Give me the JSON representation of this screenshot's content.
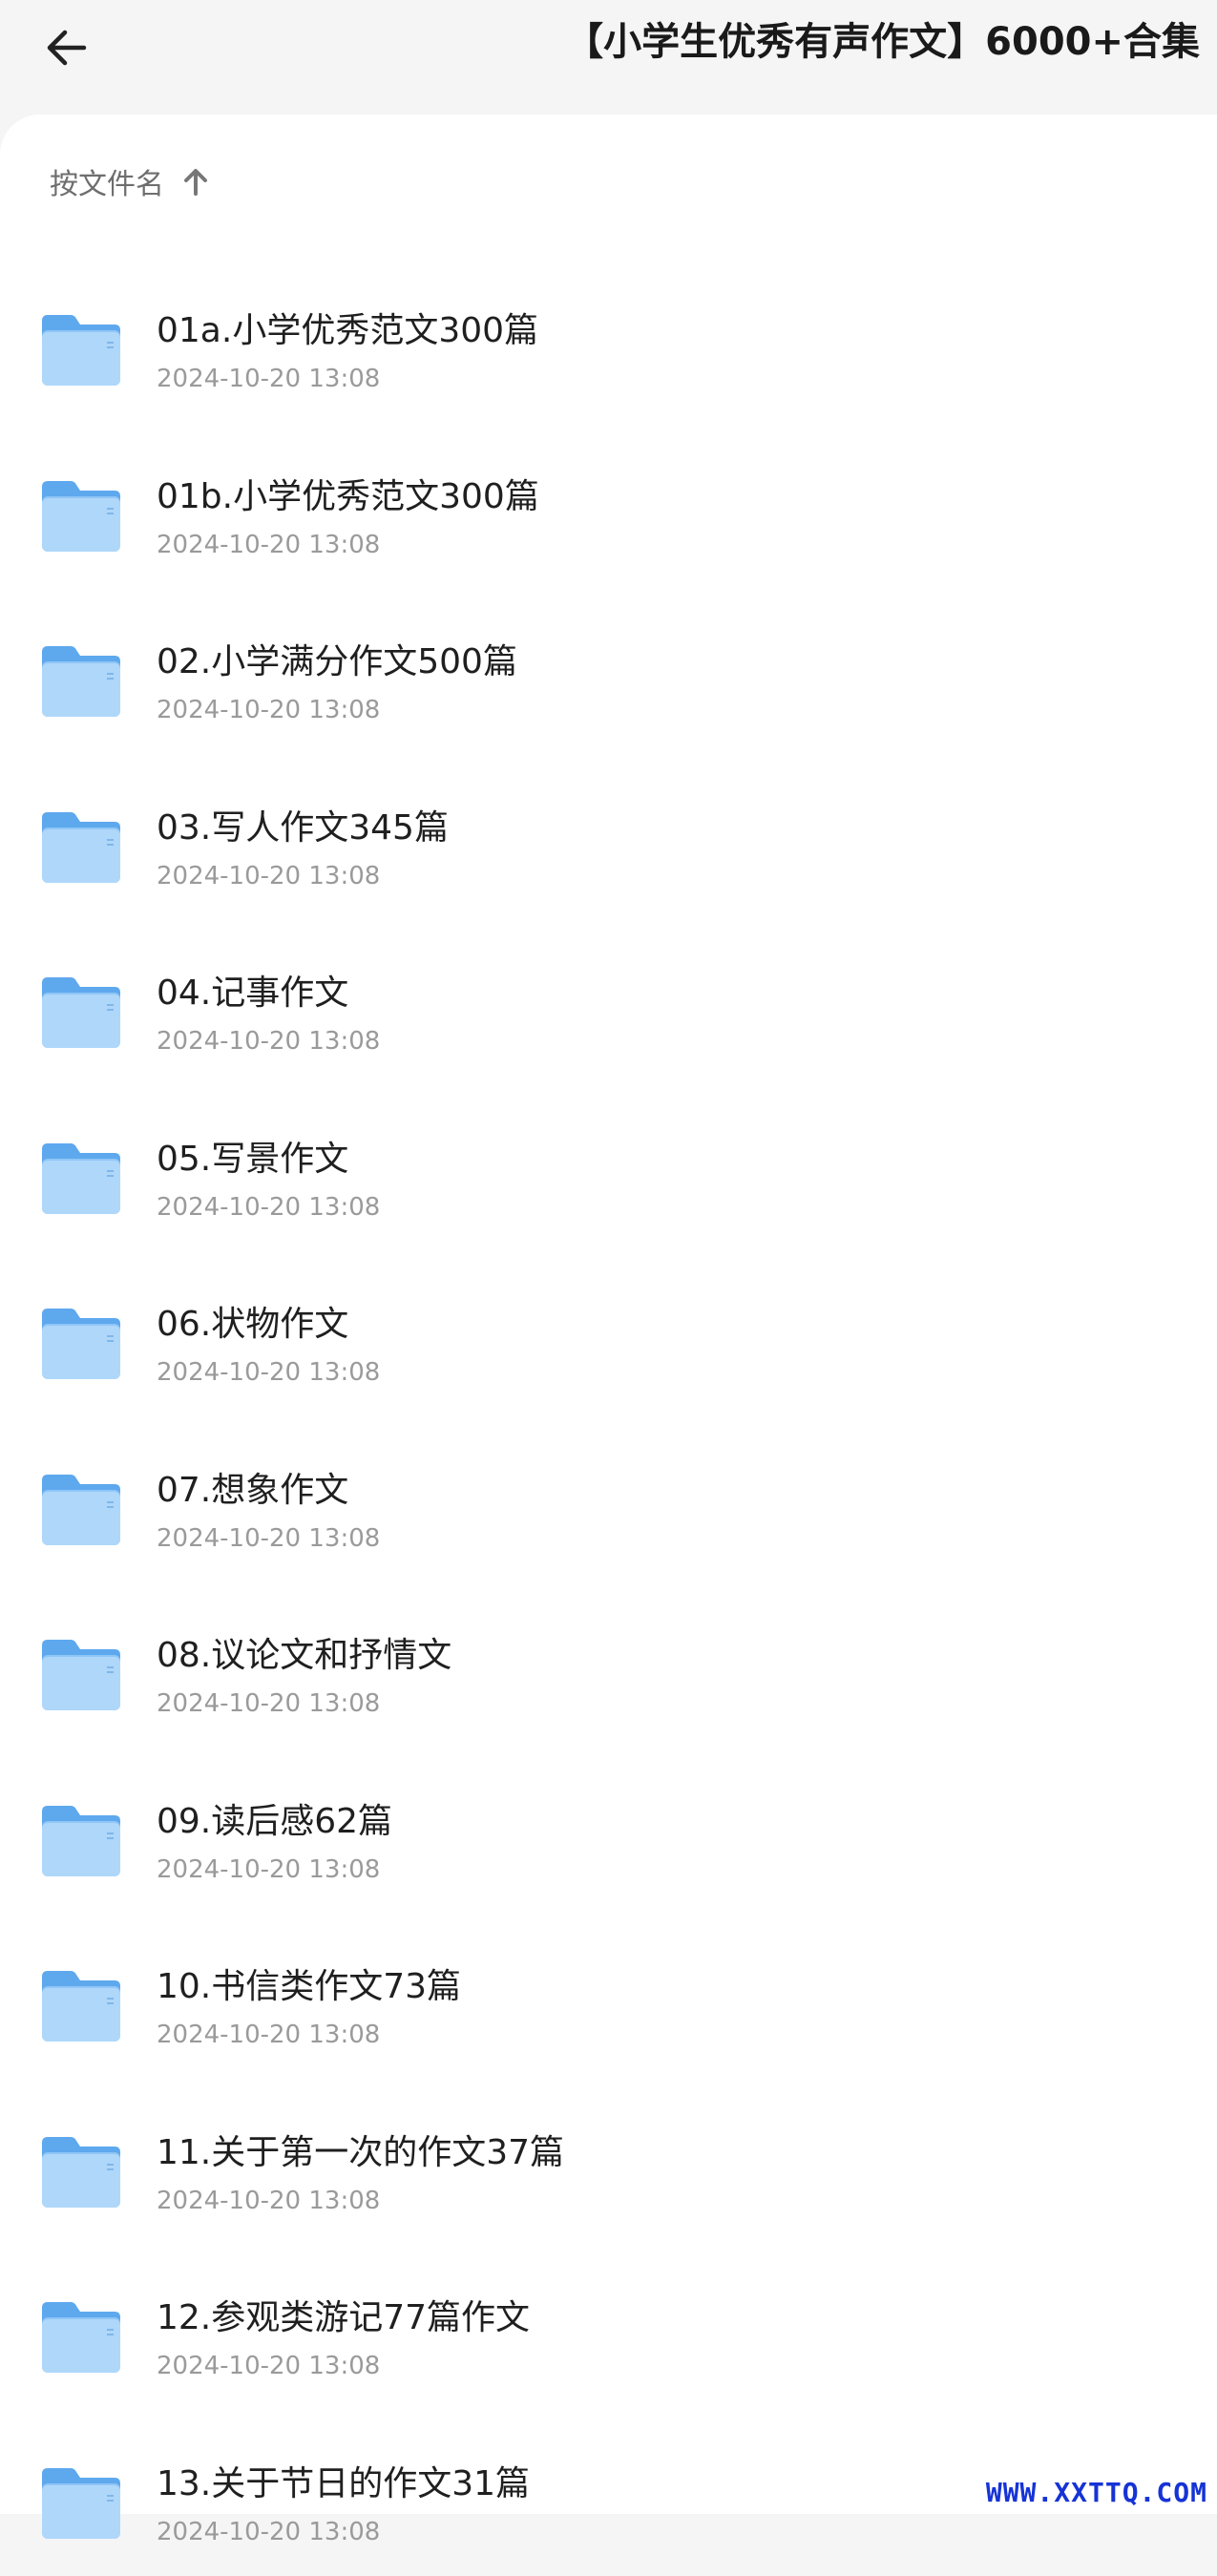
{
  "header": {
    "title": "【小学生优秀有声作文】6000+合集",
    "back_icon": "arrow-left-icon"
  },
  "sort": {
    "label": "按文件名",
    "icon": "arrow-up-icon"
  },
  "colors": {
    "folder_blue": "#72b4f2",
    "folder_light": "#c7e3fb",
    "accent_watermark": "#1633d6"
  },
  "items": [
    {
      "name": "01a.小学优秀范文300篇",
      "date": "2024-10-20 13:08"
    },
    {
      "name": "01b.小学优秀范文300篇",
      "date": "2024-10-20 13:08"
    },
    {
      "name": "02.小学满分作文500篇",
      "date": "2024-10-20 13:08"
    },
    {
      "name": "03.写人作文345篇",
      "date": "2024-10-20 13:08"
    },
    {
      "name": "04.记事作文",
      "date": "2024-10-20 13:08"
    },
    {
      "name": "05.写景作文",
      "date": "2024-10-20 13:08"
    },
    {
      "name": "06.状物作文",
      "date": "2024-10-20 13:08"
    },
    {
      "name": "07.想象作文",
      "date": "2024-10-20 13:08"
    },
    {
      "name": "08.议论文和抒情文",
      "date": "2024-10-20 13:08"
    },
    {
      "name": "09.读后感62篇",
      "date": "2024-10-20 13:08"
    },
    {
      "name": "10.书信类作文73篇",
      "date": "2024-10-20 13:08"
    },
    {
      "name": "11.关于第一次的作文37篇",
      "date": "2024-10-20 13:08"
    },
    {
      "name": "12.参观类游记77篇作文",
      "date": "2024-10-20 13:08"
    },
    {
      "name": "13.关于节日的作文31篇",
      "date": "2024-10-20 13:08"
    }
  ],
  "watermark": "WWW.XXTTQ.COM"
}
